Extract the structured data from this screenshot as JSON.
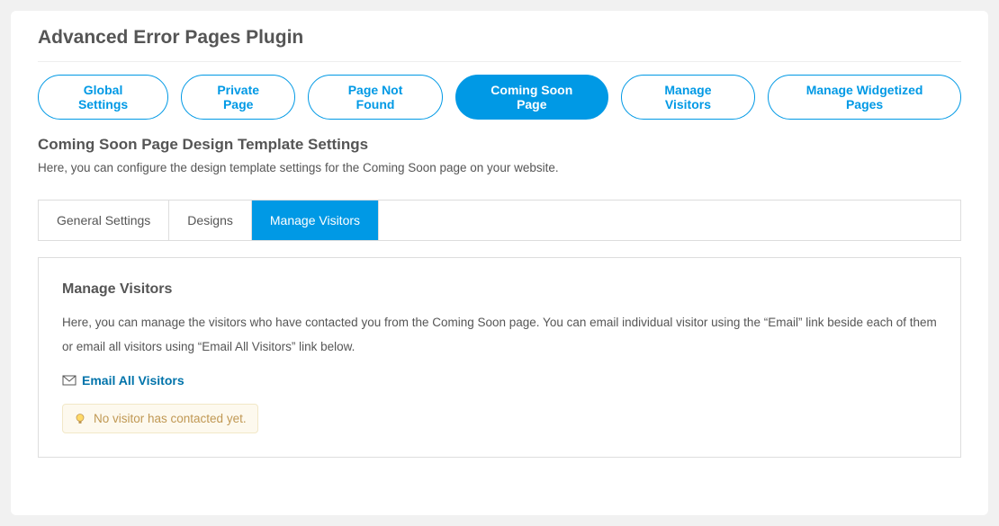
{
  "page_title": "Advanced Error Pages Plugin",
  "pills": [
    {
      "label": "Global Settings",
      "active": false
    },
    {
      "label": "Private Page",
      "active": false
    },
    {
      "label": "Page Not Found",
      "active": false
    },
    {
      "label": "Coming Soon Page",
      "active": true
    },
    {
      "label": "Manage Visitors",
      "active": false
    },
    {
      "label": "Manage Widgetized Pages",
      "active": false
    }
  ],
  "section": {
    "title": "Coming Soon Page Design Template Settings",
    "desc": "Here, you can configure the design template settings for the Coming Soon page on your website."
  },
  "tabs": [
    {
      "label": "General Settings",
      "active": false
    },
    {
      "label": "Designs",
      "active": false
    },
    {
      "label": "Manage Visitors",
      "active": true
    }
  ],
  "content": {
    "title": "Manage Visitors",
    "desc": "Here, you can manage the visitors who have contacted you from the Coming Soon page. You can email individual visitor using the “Email” link beside each of them or email all visitors using “Email All Visitors” link below.",
    "email_link": "Email All Visitors",
    "notice": "No visitor has contacted yet."
  }
}
